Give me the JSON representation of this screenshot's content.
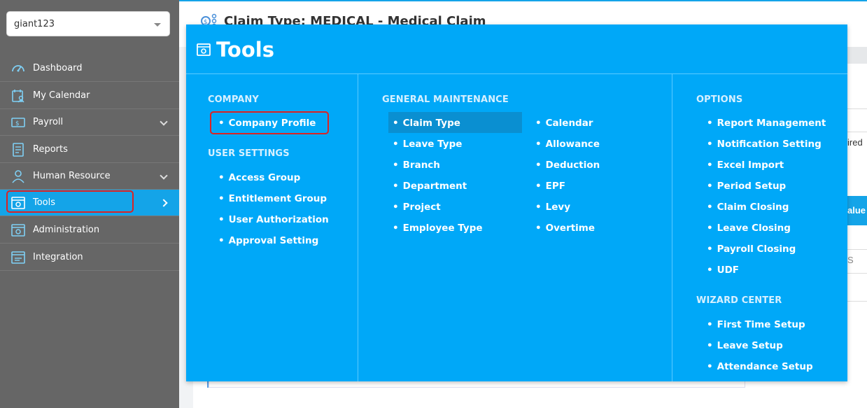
{
  "company_select": {
    "value": "giant123"
  },
  "sidebar": {
    "items": [
      {
        "label": "Dashboard",
        "icon": "dashboard-gauge-icon"
      },
      {
        "label": "My Calendar",
        "icon": "calendar-user-icon"
      },
      {
        "label": "Payroll",
        "icon": "payroll-money-icon",
        "has_submenu": true
      },
      {
        "label": "Reports",
        "icon": "report-document-icon"
      },
      {
        "label": "Human Resource",
        "icon": "human-resource-icon",
        "has_submenu": true
      },
      {
        "label": "Tools",
        "icon": "tools-gear-window-icon",
        "active": true
      },
      {
        "label": "Administration",
        "icon": "administration-gear-icon"
      },
      {
        "label": "Integration",
        "icon": "integration-window-icon"
      }
    ]
  },
  "page": {
    "title": "Claim Type: MEDICAL - Medical Claim",
    "partial_text_required": "ired",
    "partial_button_value": "alue",
    "partial_text_s": "S"
  },
  "tools_menu": {
    "title": "Tools",
    "company": {
      "heading": "COMPANY",
      "items": [
        "Company Profile"
      ]
    },
    "user_settings": {
      "heading": "USER SETTINGS",
      "items": [
        "Access Group",
        "Entitlement Group",
        "User Authorization",
        "Approval Setting"
      ]
    },
    "general_maintenance": {
      "heading": "GENERAL MAINTENANCE",
      "col1": [
        "Claim Type",
        "Leave Type",
        "Branch",
        "Department",
        "Project",
        "Employee Type"
      ],
      "col2": [
        "Calendar",
        "Allowance",
        "Deduction",
        "EPF",
        "Levy",
        "Overtime"
      ],
      "selected": "Claim Type"
    },
    "options": {
      "heading": "OPTIONS",
      "items": [
        "Report Management",
        "Notification Setting",
        "Excel Import",
        "Period Setup",
        "Claim Closing",
        "Leave Closing",
        "Payroll Closing",
        "UDF"
      ]
    },
    "wizard_center": {
      "heading": "WIZARD CENTER",
      "items": [
        "First Time Setup",
        "Leave Setup",
        "Attendance Setup"
      ]
    }
  },
  "colors": {
    "sidebar_bg": "#666666",
    "accent": "#14a4e8",
    "menu_bg": "#00a8f8",
    "highlight_red": "#dd2222"
  }
}
